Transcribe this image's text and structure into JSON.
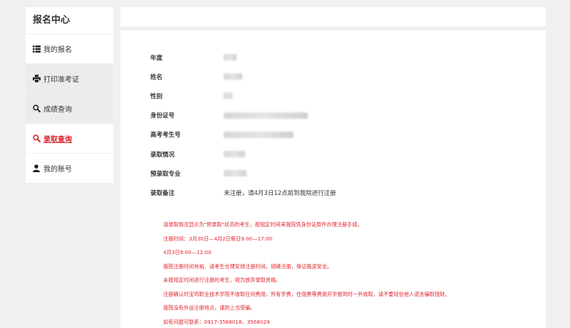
{
  "sidebar": {
    "title": "报名中心",
    "items": [
      {
        "label": "我的报名",
        "icon": "list-icon"
      },
      {
        "label": "打印准考证",
        "icon": "printer-icon"
      },
      {
        "label": "成绩查询",
        "icon": "search-icon"
      },
      {
        "label": "录取查询",
        "icon": "search-icon"
      },
      {
        "label": "我的账号",
        "icon": "user-icon"
      }
    ],
    "active_color": "#d9232c"
  },
  "info": {
    "rows": [
      {
        "label": "年度",
        "value": ""
      },
      {
        "label": "姓名",
        "value": ""
      },
      {
        "label": "性别",
        "value": ""
      },
      {
        "label": "身份证号",
        "value": ""
      },
      {
        "label": "高考考生号",
        "value": ""
      },
      {
        "label": "录取情况",
        "value": ""
      },
      {
        "label": "预录取专业",
        "value": ""
      },
      {
        "label": "录取备注",
        "value": "未注册，请4月3日12点前到我院进行注册"
      }
    ]
  },
  "notice": {
    "color": "#e0262d",
    "lines": [
      "请录取情况显示为\"预录取\"状态的考生，按规定时间来我院凭身份证原件办理注册手续。",
      "注册时间：3月30日—4月2日每日9:00—17:00",
      "4月3日9:00—12:00",
      "我院注册时间充裕，请考生合理安排注册时间，错峰注册，保证路途安全。",
      "未按规定时间进行注册的考生，视为放弃录取资格。",
      "注册确认时宝鸡职业技术学院不收取任何费用，所有学费，住宿费等费用开学报到时一并收取，请不要轻信他人谎言骗取钱财。",
      "我院没有外设注册地点，谨防上当受骗。",
      "如有问题可联系：0917-3568018、3568029"
    ]
  }
}
